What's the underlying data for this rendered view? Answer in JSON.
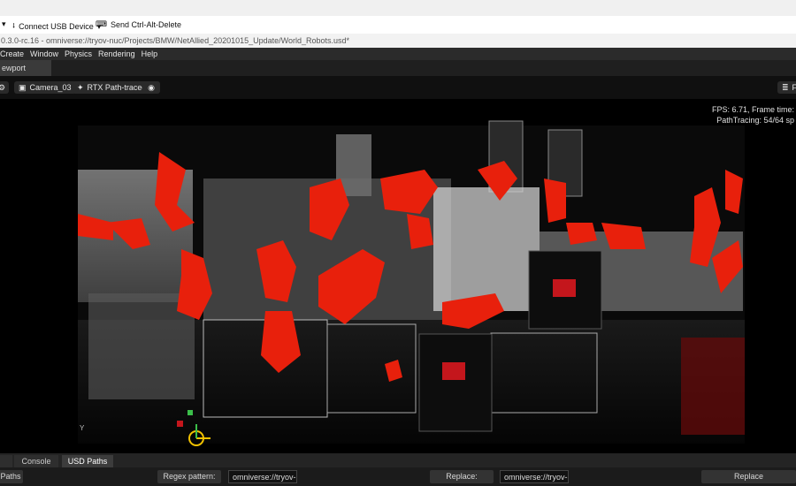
{
  "remote_toolbar": {
    "usb_label": "Connect USB Device",
    "ctrl_alt_del_label": "Send Ctrl-Alt-Delete"
  },
  "path_bar": {
    "text": "0.3.0-rc.16 - omniverse://tryov-nuc/Projects/BMW/NetAllied_20201015_Update/World_Robots.usd*"
  },
  "menu": [
    "Create",
    "Window",
    "Physics",
    "Rendering",
    "Help"
  ],
  "viewport_tab": {
    "label": "ewport"
  },
  "viewport_toolbar": {
    "camera_label": "Camera_03",
    "render_mode_label": "RTX Path-traced",
    "right_label": "F"
  },
  "stats": {
    "fps_line": "FPS: 6.71, Frame time:",
    "path_tracing_line": "PathTracing: 54/64 sp"
  },
  "bottom_tabs": [
    {
      "label": "Console",
      "active": false
    },
    {
      "label": "USD Paths",
      "active": true
    }
  ],
  "bottom_bar": {
    "left_label": "Paths",
    "regex_label": "Regex pattern:",
    "regex_value": "omniverse://tryov-nu",
    "replace_label": "Replace:",
    "replace_value": "omniverse://tryov-nu",
    "replace_button": "Replace"
  },
  "colors": {
    "robot": "#e8200c",
    "viewport_bg": "#000000",
    "panel_bg": "#1f1f1f"
  }
}
